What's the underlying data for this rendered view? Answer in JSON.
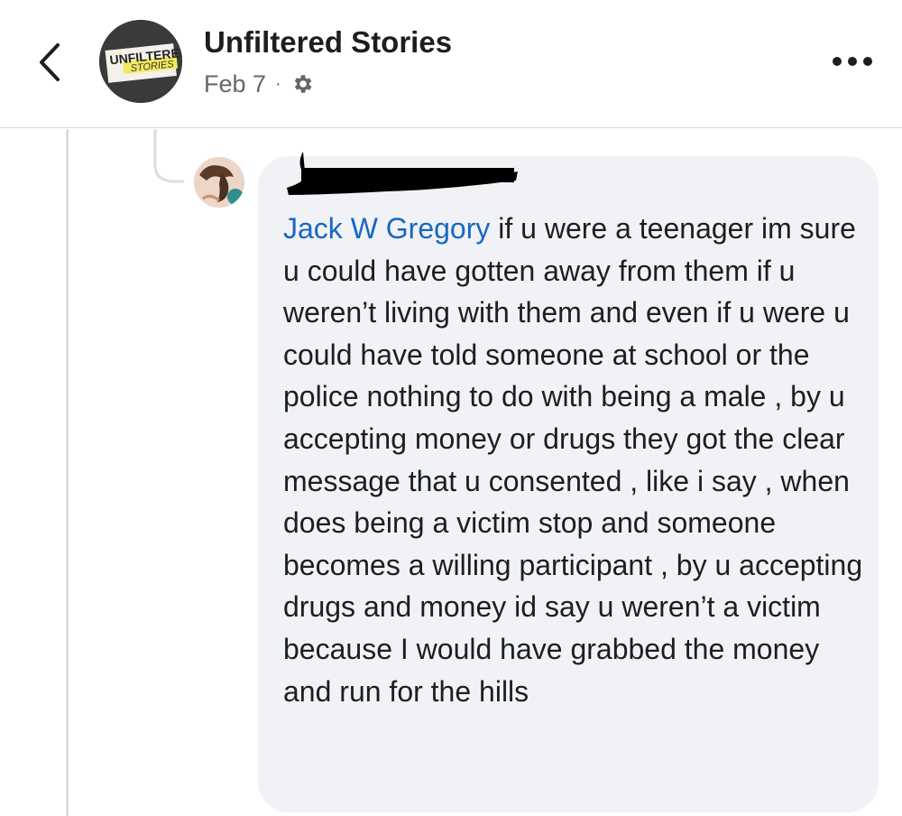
{
  "header": {
    "back_icon": "chevron-left-icon",
    "page_avatar_text_top": "UNFILTERED",
    "page_avatar_text_bottom": "STORIES",
    "page_name": "Unfiltered Stories",
    "date": "Feb 7",
    "separator": "·",
    "privacy_icon": "gear-icon",
    "more_icon": "more-horizontal-icon"
  },
  "comment": {
    "author_redacted": true,
    "mention": "Jack W Gregory",
    "body": " if u were a teenager im sure u could have gotten away from them if u weren’t living with them and even if u were u could have told someone at school or the police nothing to do with being a male , by u accepting money or drugs they got the clear message that u consented , like i say , when does being a victim stop and someone becomes a willing participant , by u accepting drugs and money id say u weren’t a victim because I would have grabbed the money and run for the hills"
  },
  "colors": {
    "mention": "#1a66c4",
    "bubble": "#f0f2f5",
    "secondary_text": "#65676b"
  }
}
